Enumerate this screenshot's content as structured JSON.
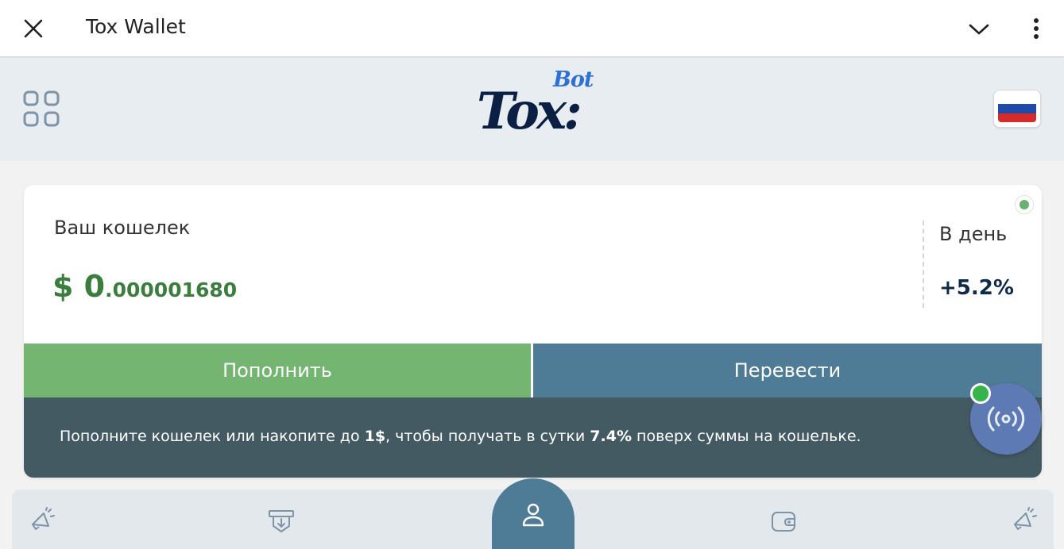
{
  "app": {
    "title": "Tox Wallet",
    "close_icon": "close-icon",
    "collapse_icon": "chevron-down-icon",
    "menu_icon": "more-vertical-icon"
  },
  "header": {
    "menu_icon": "grid-icon",
    "logo": {
      "main": "Tox:",
      "super": "Bot"
    },
    "language": "ru",
    "flag_colors": [
      "#ffffff",
      "#1f4aa8",
      "#d52b2b"
    ]
  },
  "wallet": {
    "label": "Ваш кошелек",
    "balance_main": "$ 0",
    "balance_fraction": ".000001680",
    "per_day_label": "В день",
    "per_day_value": "+5.2%",
    "status": "online"
  },
  "actions": {
    "topup_label": "Пополнить",
    "transfer_label": "Перевести"
  },
  "info": {
    "text_1": "Пополните кошелек или накопите до ",
    "amount": "1$",
    "text_2": ", чтобы получать в сутки ",
    "percent": "7.4%",
    "text_3": " поверх суммы на кошельке."
  },
  "fab": {
    "icon": "broadcast-icon",
    "status": "online"
  },
  "bottom_nav": {
    "items": [
      {
        "icon": "megaphone-icon"
      },
      {
        "icon": "atm-withdraw-icon"
      },
      {
        "icon": "user-icon",
        "active": true
      },
      {
        "icon": "wallet-icon"
      },
      {
        "icon": "megaphone-icon"
      }
    ]
  },
  "colors": {
    "accent_green": "#74b572",
    "accent_blue": "#4e7b96",
    "info_bg": "#445a63",
    "balance_green": "#3a7d3c",
    "fab_blue": "#5e7ab4",
    "status_green": "#36b34a"
  }
}
